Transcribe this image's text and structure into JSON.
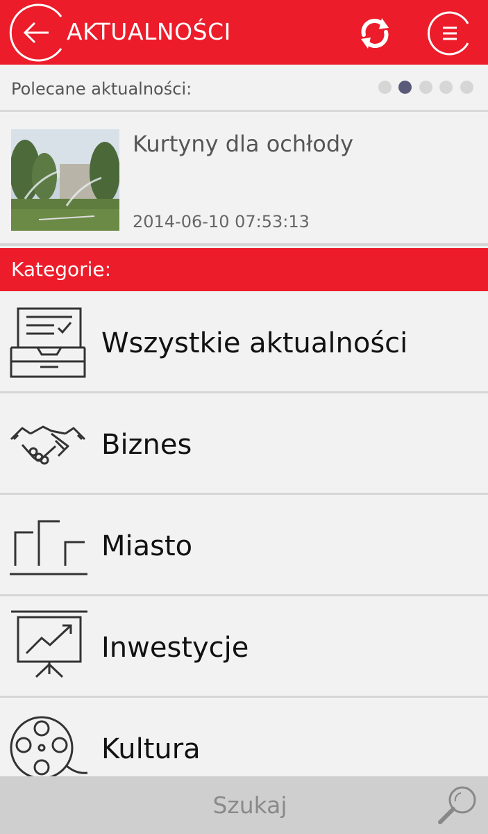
{
  "header": {
    "title": "AKTUALNOŚCI",
    "back_icon": "back-arrow-icon",
    "refresh_icon": "refresh-icon",
    "menu_icon": "menu-icon",
    "accent_color": "#ec1c2a"
  },
  "featured": {
    "label": "Polecane aktualności:",
    "dots_total": 5,
    "active_dot_index": 1
  },
  "news": {
    "title": "Kurtyny dla ochłody",
    "date": "2014-06-10 07:53:13"
  },
  "categories": {
    "label": "Kategorie:",
    "items": [
      {
        "label": "Wszystkie aktualności",
        "icon": "inbox-tray-icon"
      },
      {
        "label": "Biznes",
        "icon": "handshake-icon"
      },
      {
        "label": "Miasto",
        "icon": "city-buildings-icon"
      },
      {
        "label": "Inwestycje",
        "icon": "presentation-chart-icon"
      },
      {
        "label": "Kultura",
        "icon": "film-reel-icon"
      }
    ]
  },
  "search": {
    "placeholder": "Szukaj",
    "icon": "search-icon"
  }
}
